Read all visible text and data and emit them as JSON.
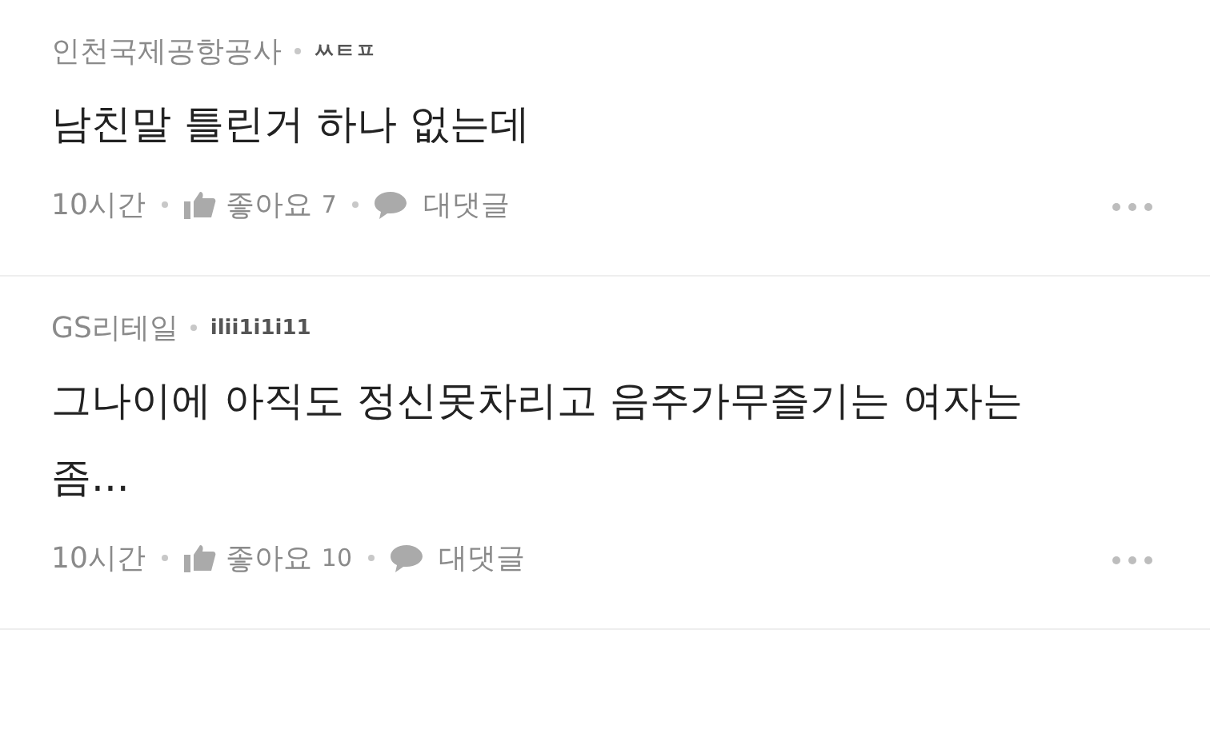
{
  "comments": [
    {
      "company": "인천국제공항공사",
      "nickname": "ㅆㅌㅍ",
      "body": "남친말 틀린거 하나 없는데",
      "time": "10시간",
      "like_label": "좋아요",
      "like_count": "7",
      "reply_label": "대댓글"
    },
    {
      "company": "GS리테일",
      "nickname": "ilii1i1i11",
      "body": "그나이에 아직도 정신못차리고 음주가무즐기는 여자는 좀...",
      "time": "10시간",
      "like_label": "좋아요",
      "like_count": "10",
      "reply_label": "대댓글"
    }
  ]
}
